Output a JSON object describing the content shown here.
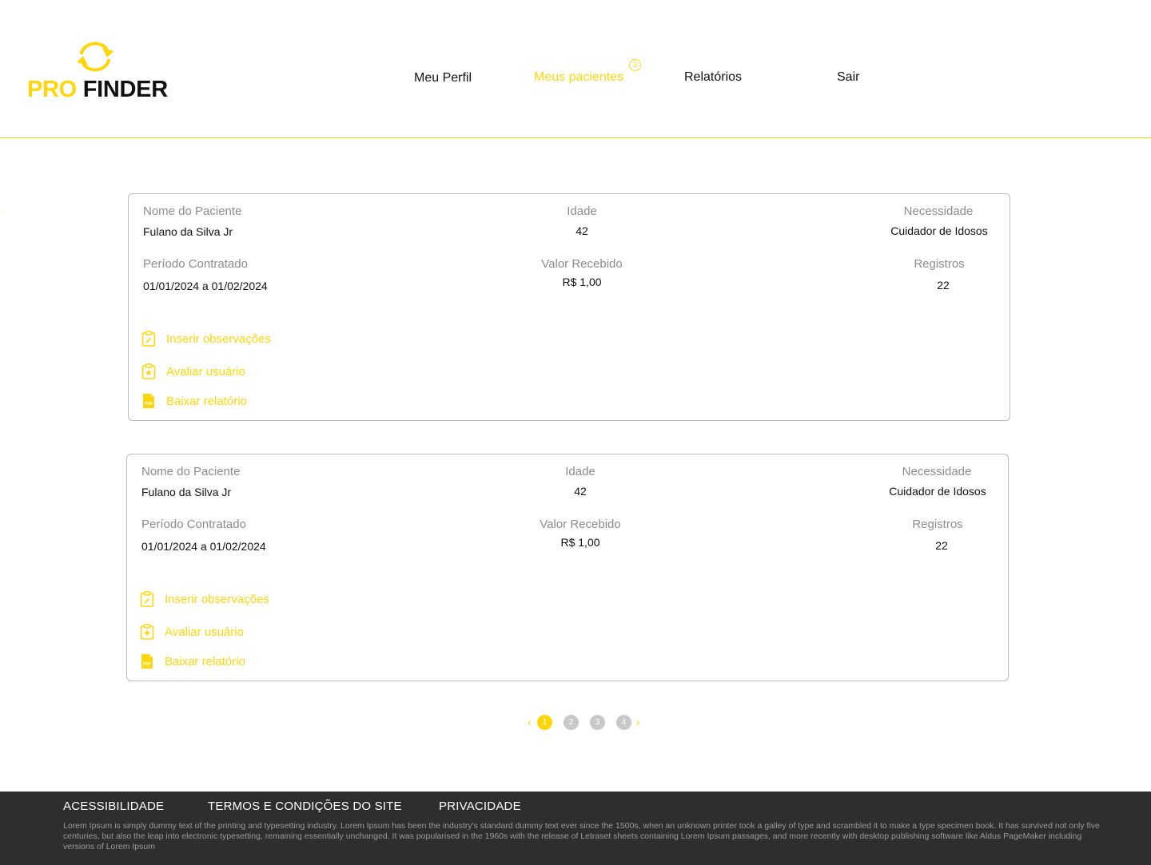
{
  "brand": {
    "logo_pro": "PRO",
    "logo_finder": "FINDER",
    "accent_color": "#FFD60A",
    "icon": "refresh-arrows-icon"
  },
  "nav": {
    "profile": "Meu Perfil",
    "patients": "Meus pacientes",
    "patients_badge": "3",
    "reports": "Relatórios",
    "logout": "Sair"
  },
  "cards": [
    {
      "name_label": "Nome do Paciente",
      "name_value": "Fulano da Silva Jr",
      "age_label": "Idade",
      "age_value": "42",
      "need_label": "Necessidade",
      "need_value": "Cuidador de Idosos",
      "period_label": "Período Contratado",
      "period_value": "01/01/2024 a 01/02/2024",
      "amount_label": "Valor Recebido",
      "amount_value": "R$ 1,00",
      "records_label": "Registros",
      "records_value": "22",
      "actions": {
        "notes": "Inserir observações",
        "rate": "Avaliar usuário",
        "download": "Baixar relatório"
      }
    },
    {
      "name_label": "Nome do Paciente",
      "name_value": "Fulano da Silva Jr",
      "age_label": "Idade",
      "age_value": "42",
      "need_label": "Necessidade",
      "need_value": "Cuidador de Idosos",
      "period_label": "Período Contratado",
      "period_value": "01/01/2024 a 01/02/2024",
      "amount_label": "Valor Recebido",
      "amount_value": "R$ 1,00",
      "records_label": "Registros",
      "records_value": "22",
      "actions": {
        "notes": "Inserir observações",
        "rate": "Avaliar usuário",
        "download": "Baixar relatório"
      }
    }
  ],
  "pagination": {
    "prev": "‹",
    "next": "›",
    "pages": [
      "1",
      "2",
      "3",
      "4"
    ],
    "current": "1"
  },
  "footer": {
    "links": [
      "ACESSIBILIDADE",
      "TERMOS E CONDIÇÕES DO SITE",
      "PRIVACIDADE"
    ],
    "text": "Lorem Ipsum is simply dummy text of the printing and typesetting industry. Lorem Ipsum has been the industry's standard dummy text ever since the 1500s, when an unknown printer took a galley of type and scrambled it to make a type specimen book. It has survived not only five centuries, but also the leap into electronic typesetting, remaining essentially unchanged. It was popularised in the 1960s with the release of Letraset sheets containing Lorem Ipsum passages, and more recently with desktop publishing software like Aldus PageMaker including versions of Lorem Ipsum"
  }
}
